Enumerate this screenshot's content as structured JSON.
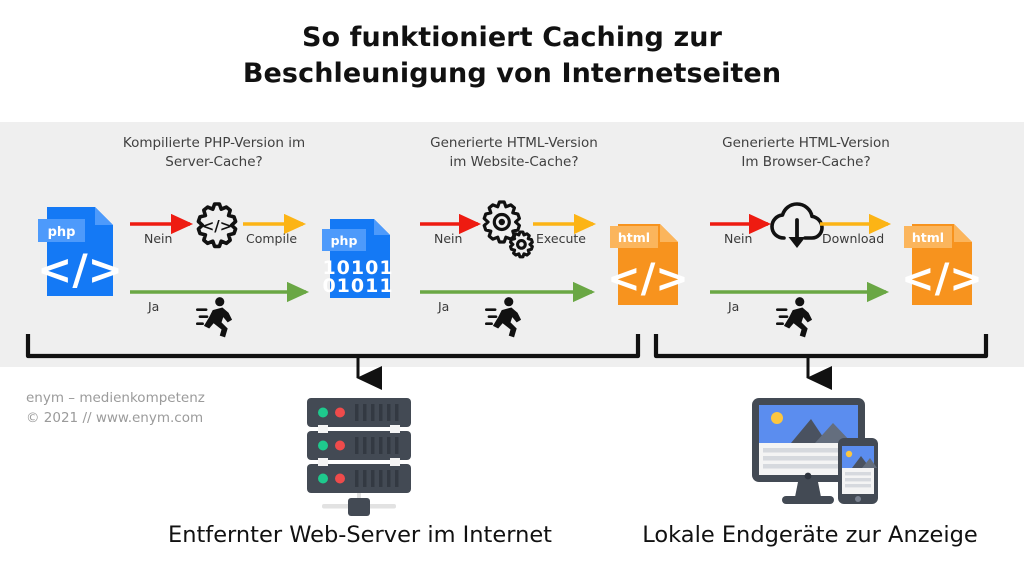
{
  "title": {
    "line1": "So funktioniert Caching zur",
    "line2": "Beschleunigung von Internetseiten"
  },
  "columns": [
    {
      "id": "server-cache",
      "head_line1": "Kompilierte PHP-Version im",
      "head_line2": "Server-Cache?",
      "source_icon": {
        "name": "php-source-file-icon",
        "badge": "php",
        "glyph": "</>",
        "color": "#1479f5"
      },
      "no_label": "Nein",
      "process_icon": {
        "name": "gear-code-icon"
      },
      "action_label": "Compile",
      "result_icon": {
        "name": "php-compiled-file-icon",
        "badge": "php",
        "glyph_line1": "10101",
        "glyph_line2": "01011",
        "color": "#1479f5"
      },
      "yes_label": "Ja",
      "fast_icon": {
        "name": "running-person-icon"
      }
    },
    {
      "id": "website-cache",
      "head_line1": "Generierte HTML-Version",
      "head_line2": "im Website-Cache?",
      "no_label": "Nein",
      "process_icon": {
        "name": "gears-icon"
      },
      "action_label": "Execute",
      "result_icon": {
        "name": "html-file-icon",
        "badge": "html",
        "glyph": "</>",
        "color": "#f7931e"
      },
      "yes_label": "Ja",
      "fast_icon": {
        "name": "running-person-icon"
      }
    },
    {
      "id": "browser-cache",
      "head_line1": "Generierte HTML-Version",
      "head_line2": "Im Browser-Cache?",
      "no_label": "Nein",
      "process_icon": {
        "name": "cloud-download-icon"
      },
      "action_label": "Download",
      "result_icon": {
        "name": "html-file-icon",
        "badge": "html",
        "glyph": "</>",
        "color": "#f7931e"
      },
      "yes_label": "Ja",
      "fast_icon": {
        "name": "running-person-icon"
      }
    }
  ],
  "outputs": [
    {
      "id": "server",
      "icon": "server-rack-icon",
      "caption": "Entfernter Web-Server im Internet"
    },
    {
      "id": "devices",
      "icon": "desktop-and-phone-icon",
      "caption": "Lokale Endgeräte zur Anzeige"
    }
  ],
  "credit": {
    "line1": "enym – medienkompetenz",
    "line2": "© 2021  //  www.enym.com"
  },
  "colors": {
    "panel_bg": "#efefef",
    "page_bg": "#ffffff",
    "arrow_no": "#ee1b11",
    "arrow_action": "#fcb415",
    "arrow_yes": "#6aa744",
    "php_blue": "#1479f5",
    "html_orange": "#f7931e",
    "server_slate": "#434a54",
    "led_green": "#1ec98d",
    "led_red": "#ef4b4b",
    "bracket": "#111111",
    "title_text": "#111111",
    "head_text": "#404040",
    "credit_text": "#9b9b9b"
  }
}
